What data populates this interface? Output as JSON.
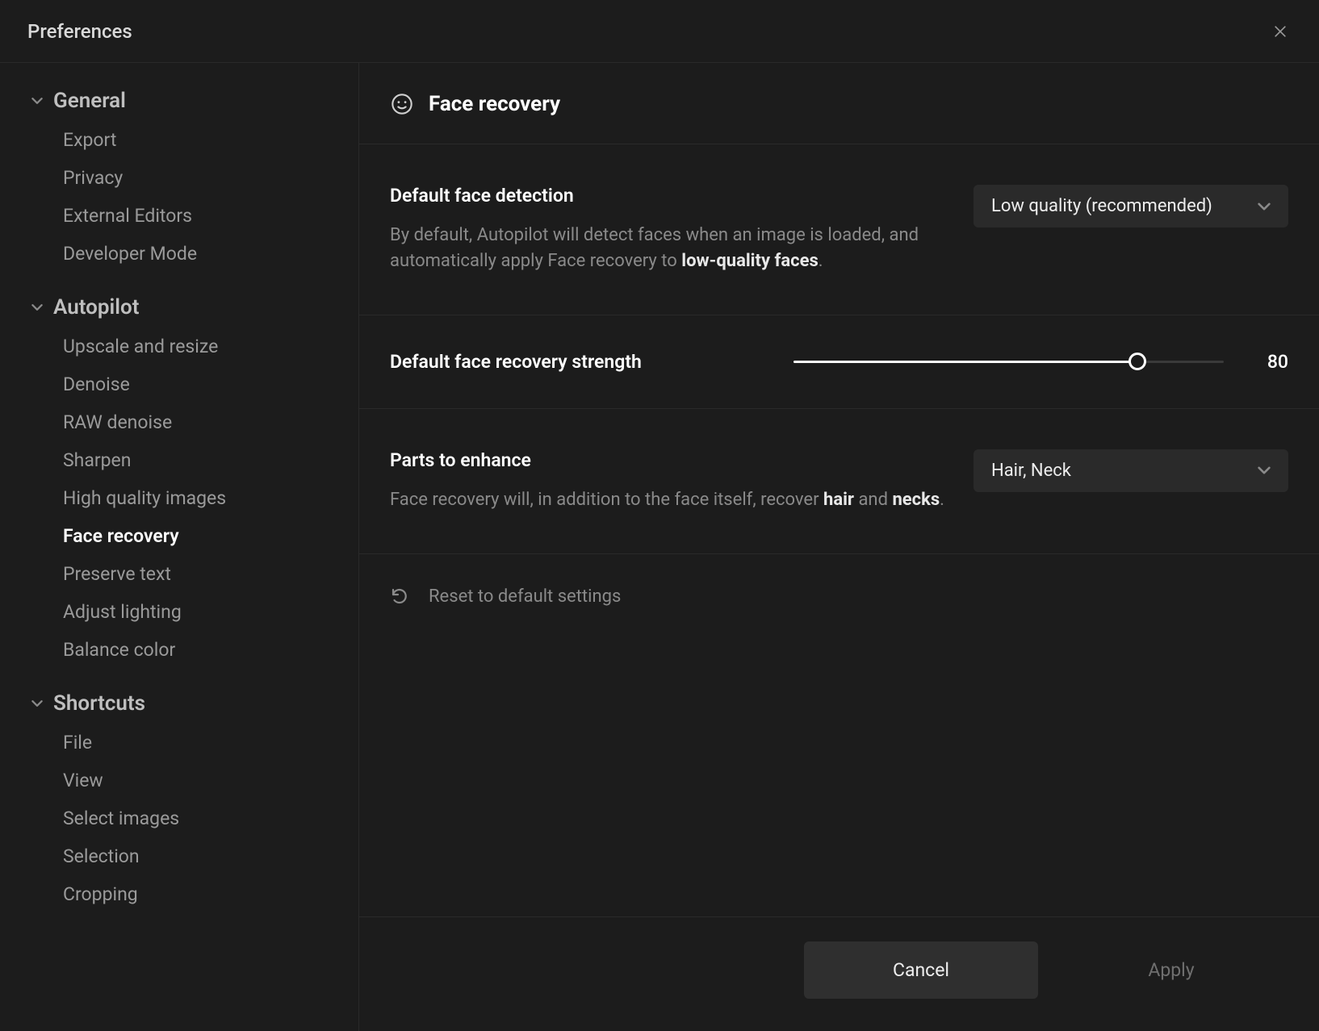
{
  "window": {
    "title": "Preferences"
  },
  "sidebar": {
    "groups": [
      {
        "label": "General",
        "items": [
          {
            "label": "Export"
          },
          {
            "label": "Privacy"
          },
          {
            "label": "External Editors"
          },
          {
            "label": "Developer Mode"
          }
        ]
      },
      {
        "label": "Autopilot",
        "items": [
          {
            "label": "Upscale and resize"
          },
          {
            "label": "Denoise"
          },
          {
            "label": "RAW denoise"
          },
          {
            "label": "Sharpen"
          },
          {
            "label": "High quality images"
          },
          {
            "label": "Face recovery",
            "active": true
          },
          {
            "label": "Preserve text"
          },
          {
            "label": "Adjust lighting"
          },
          {
            "label": "Balance color"
          }
        ]
      },
      {
        "label": "Shortcuts",
        "items": [
          {
            "label": "File"
          },
          {
            "label": "View"
          },
          {
            "label": "Select images"
          },
          {
            "label": "Selection"
          },
          {
            "label": "Cropping"
          }
        ]
      }
    ]
  },
  "page": {
    "title": "Face recovery",
    "sections": {
      "detection": {
        "title": "Default face detection",
        "desc_pre": "By default, Autopilot will detect faces when an image is loaded, and automatically apply Face recovery to ",
        "desc_bold": "low-quality faces",
        "desc_post": ".",
        "select_value": "Low quality (recommended)"
      },
      "strength": {
        "label": "Default face recovery strength",
        "value": 80,
        "min": 0,
        "max": 100
      },
      "parts": {
        "title": "Parts to enhance",
        "desc_pre": "Face recovery will, in addition to the face itself, recover ",
        "desc_bold1": "hair",
        "desc_mid": " and ",
        "desc_bold2": "necks",
        "desc_post": ".",
        "select_value": "Hair, Neck"
      }
    },
    "reset_label": "Reset to default settings"
  },
  "footer": {
    "cancel": "Cancel",
    "apply": "Apply"
  }
}
